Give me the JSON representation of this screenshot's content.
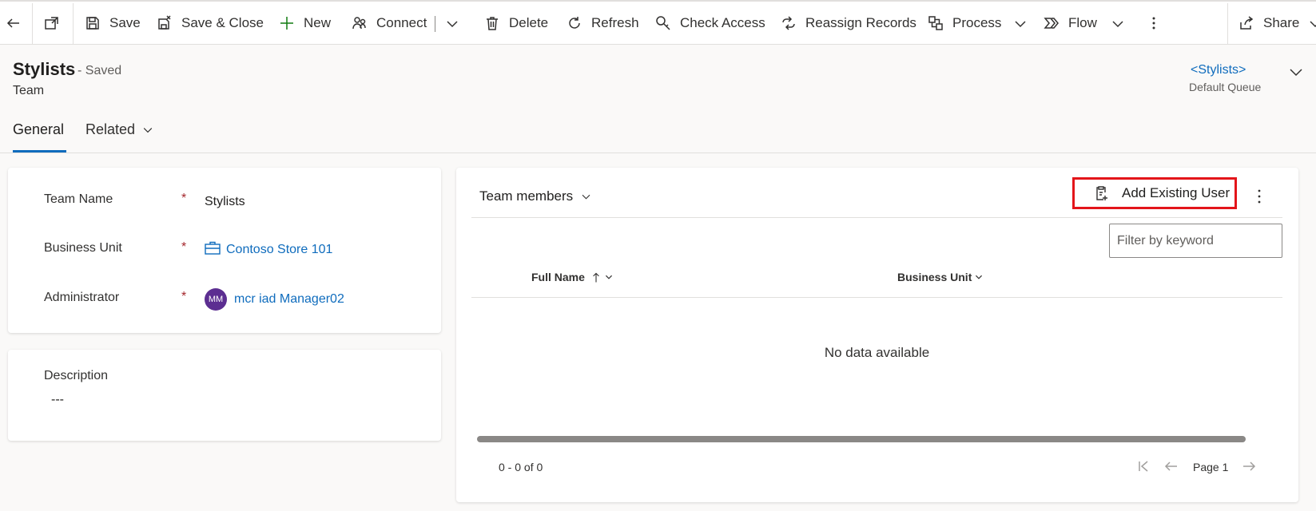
{
  "commandbar": {
    "save": "Save",
    "save_close": "Save & Close",
    "new": "New",
    "connect": "Connect",
    "delete": "Delete",
    "refresh": "Refresh",
    "check_access": "Check Access",
    "reassign": "Reassign Records",
    "process": "Process",
    "flow": "Flow",
    "share": "Share"
  },
  "header": {
    "title": "Stylists",
    "status": "- Saved",
    "entity": "Team",
    "queue_link": "<Stylists>",
    "queue_label": "Default Queue"
  },
  "tabs": [
    {
      "label": "General",
      "active": true
    },
    {
      "label": "Related",
      "active": false
    }
  ],
  "form": {
    "team_name_label": "Team Name",
    "team_name_value": "Stylists",
    "business_unit_label": "Business Unit",
    "business_unit_value": "Contoso Store 101",
    "administrator_label": "Administrator",
    "administrator_initials": "MM",
    "administrator_value": "mcr iad Manager02",
    "required_marker": "*",
    "description_label": "Description",
    "description_value": "---"
  },
  "subgrid": {
    "title": "Team members",
    "add_existing_user": "Add Existing User",
    "filter_placeholder": "Filter by keyword",
    "columns": [
      "Full Name",
      "Business Unit"
    ],
    "empty_message": "No data available",
    "record_count": "0 - 0 of 0",
    "page_label": "Page 1"
  },
  "colors": {
    "accent": "#0f6cbd",
    "required": "#a4262c",
    "highlight_box": "#e3151a",
    "avatar": "#5c2e91"
  }
}
